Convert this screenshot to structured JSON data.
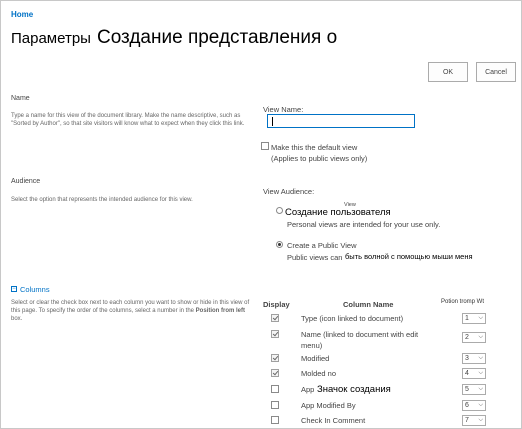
{
  "breadcrumb": {
    "home": "Home"
  },
  "title": {
    "part1": "Параметры",
    "part2": "Создание представления о"
  },
  "buttons": {
    "ok": "OK",
    "cancel": "Cancel"
  },
  "name_section": {
    "title": "Name",
    "description": "Type a name for this view of the document library. Make the name descriptive, such as \"Sorted by Author\", so that site visitors will know what to expect when they click this link.",
    "view_name_label": "View Name:",
    "view_name_value": "",
    "default_view_label": "Make this the default view",
    "default_view_note": "(Applies to public views only)",
    "default_view_checked": false
  },
  "audience_section": {
    "title": "Audience",
    "description": "Select the option that represents the intended audience for this view.",
    "label": "View Audience:",
    "personal_overlay_small": "View",
    "personal_label": "Создание пользователя",
    "personal_desc": "Personal views are intended for your use only.",
    "public_label": "Create a Public View",
    "public_desc_prefix": "Public views can",
    "public_desc_overlay": "быть волной с помощью мыши меня",
    "selected": "public"
  },
  "columns_section": {
    "title": "Columns",
    "expand_icon": "minus-box-icon",
    "description_1": "Select or clear the check box next to each column you want to show or hide in this view of this page. To specify the order of the columns, select a number in the",
    "description_2": "box.",
    "description_bold": "Position from left",
    "header_display": "Display",
    "header_column_name": "Column Name",
    "header_position": "Potion tromp Wt",
    "rows": [
      {
        "name": "Type (icon linked to document)",
        "checked": true,
        "position": "1"
      },
      {
        "name": "Name (linked to document with edit",
        "name2": "menu)",
        "checked": true,
        "position": "2"
      },
      {
        "name": "Modified",
        "checked": true,
        "position": "3"
      },
      {
        "name": "Molded no",
        "checked": true,
        "position": "4"
      },
      {
        "name": "App",
        "overlay": "Значок создания",
        "checked": false,
        "position": "5"
      },
      {
        "name": "App Modified By",
        "checked": false,
        "position": "6"
      },
      {
        "name": "Check In Comment",
        "checked": false,
        "position": "7"
      }
    ]
  }
}
